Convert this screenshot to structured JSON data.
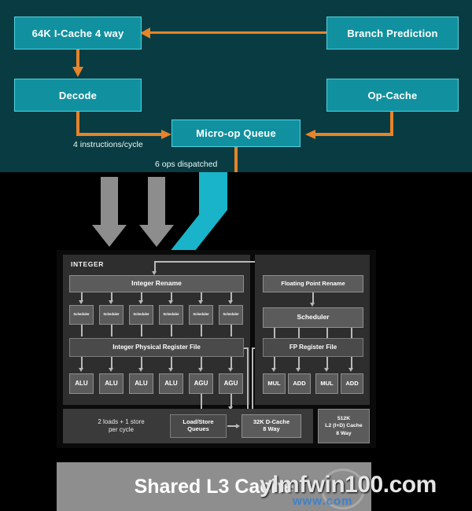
{
  "diagram": {
    "title": "Shared L3 Cache",
    "frontend": {
      "background_color": "#083c42",
      "box_color": "#11919f",
      "arrow_color": "#e8832a",
      "boxes": [
        {
          "id": "icache",
          "label": "64K I-Cache 4 way"
        },
        {
          "id": "branch",
          "label": "Branch Prediction"
        },
        {
          "id": "decode",
          "label": "Decode"
        },
        {
          "id": "opcache",
          "label": "Op-Cache"
        },
        {
          "id": "uopqueue",
          "label": "Micro-op Queue"
        }
      ],
      "annotations": [
        {
          "id": "instr-rate",
          "text": "4 instructions/cycle"
        },
        {
          "id": "dispatch-rate",
          "text": "6 ops dispatched"
        }
      ]
    },
    "core": {
      "integer": {
        "section_label": "INTEGER",
        "rename": "Integer Rename",
        "schedulers": [
          "Scheduler",
          "Scheduler",
          "Scheduler",
          "Scheduler",
          "Scheduler",
          "Scheduler"
        ],
        "register_file": "Integer Physical Register File",
        "execution_units": [
          "ALU",
          "ALU",
          "ALU",
          "ALU",
          "AGU",
          "AGU"
        ]
      },
      "floating_point": {
        "rename": "Floating Point Rename",
        "scheduler": "Scheduler",
        "register_file": "FP Register File",
        "execution_units": [
          "MUL",
          "ADD",
          "MUL",
          "ADD"
        ]
      },
      "memory": {
        "note": "2 loads + 1 store\nper cycle",
        "note_line1": "2 loads + 1 store",
        "note_line2": "per cycle",
        "load_store_queues": "Load/Store\nQueues",
        "lsq_line1": "Load/Store",
        "lsq_line2": "Queues",
        "d_cache_line1": "32K D-Cache",
        "d_cache_line2": "8 Way",
        "l2_line1": "512K",
        "l2_line2": "L2 (I+D) Cache",
        "l2_line3": "8 Way"
      }
    },
    "l3": {
      "label": "Shared L3 Cache"
    },
    "watermark": {
      "primary": "ylmfwin100.com",
      "secondary": "www.com"
    },
    "ribbon": {
      "color": "#19b4c9",
      "name": "dispatch-ribbon"
    },
    "gray_arrows": {
      "color": "#8d8d8d",
      "count": 2
    }
  }
}
